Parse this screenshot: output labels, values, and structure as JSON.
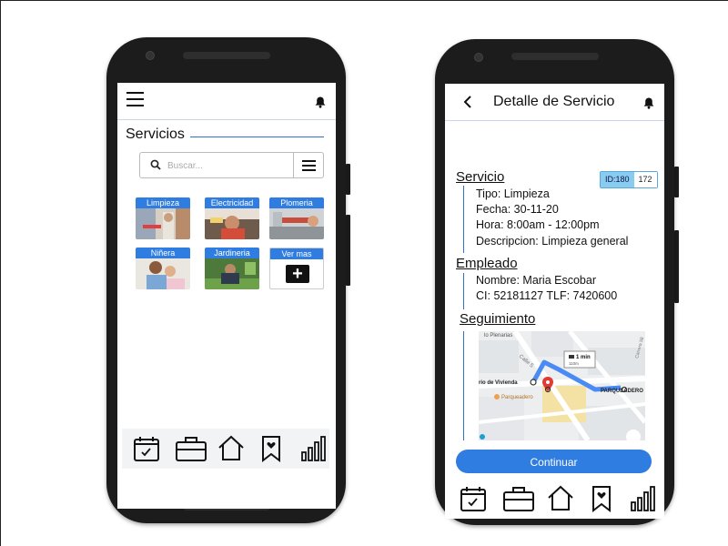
{
  "left_screen": {
    "title": "Servicios",
    "search": {
      "placeholder": "Buscar..."
    },
    "tiles": [
      {
        "label": "Limpieza"
      },
      {
        "label": "Electricidad"
      },
      {
        "label": "Plomeria"
      },
      {
        "label": "Niñera"
      },
      {
        "label": "Jardineria"
      },
      {
        "label": "Ver mas"
      }
    ],
    "nav": [
      "calendar-check-icon",
      "briefcase-icon",
      "home-icon",
      "bookmark-heart-icon",
      "bar-chart-icon"
    ]
  },
  "right_screen": {
    "title": "Detalle de Servicio",
    "badge": {
      "id_label": "ID:180",
      "count": "172"
    },
    "servicio": {
      "heading": "Servicio",
      "tipo": "Tipo: Limpieza",
      "fecha": "Fecha: 30-11-20",
      "hora": "Hora:  8:00am - 12:00pm",
      "descripcion": "Descripcion: Limpieza general"
    },
    "empleado": {
      "heading": "Empleado",
      "nombre": "Nombre: Maria Escobar",
      "ci": "CI: 52181127 TLF: 7420600"
    },
    "seguimiento": {
      "heading": "Seguimiento",
      "map_labels": {
        "top": "lo Plenarias",
        "calle": "Calle 5",
        "origin": "rio de Vivienda",
        "route_time": "1 min",
        "route_dist": "110m",
        "dest": "PARQUEADERO",
        "parqueadero": "Parqueadero",
        "carrera": "Carrera 58"
      }
    },
    "continue_label": "Continuar",
    "active_nav": "briefcase"
  },
  "colors": {
    "accent": "#2f7de1",
    "badge": "#88cdf0",
    "phone": "#1c1c1c"
  }
}
